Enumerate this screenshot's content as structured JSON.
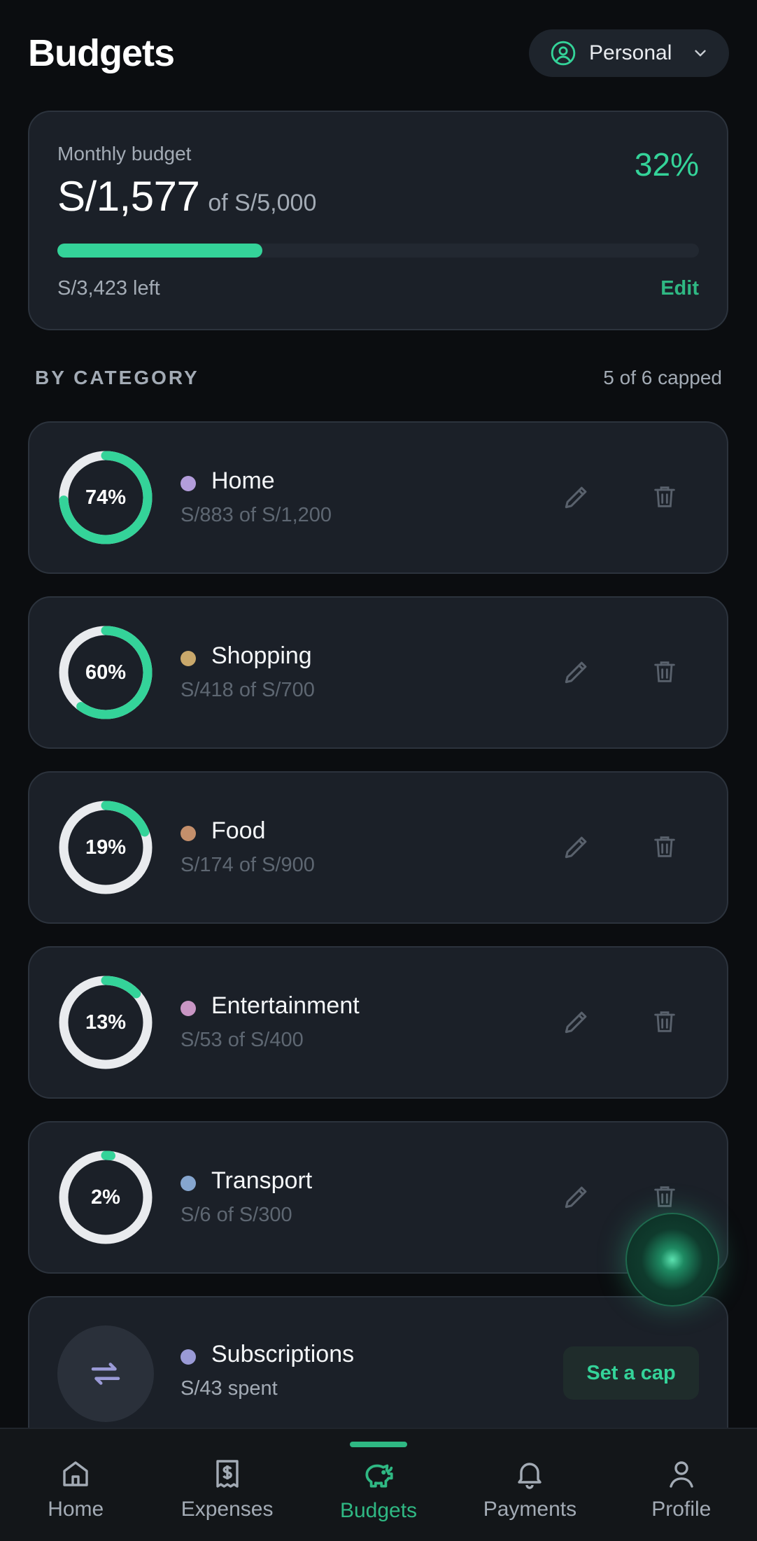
{
  "header": {
    "title": "Budgets",
    "profile_label": "Personal"
  },
  "monthly": {
    "label": "Monthly budget",
    "amount": "S/1,577",
    "of_total": "of S/5,000",
    "percent": "32%",
    "progress_fraction": 0.32,
    "left_text": "S/3,423 left",
    "edit_label": "Edit"
  },
  "section": {
    "title": "BY CATEGORY",
    "count": "5 of 6 capped"
  },
  "categories": [
    {
      "name": "Home",
      "sub": "S/883 of S/1,200",
      "percent_label": "74%",
      "fraction": 0.74,
      "dot_color": "#b39ddb"
    },
    {
      "name": "Shopping",
      "sub": "S/418 of S/700",
      "percent_label": "60%",
      "fraction": 0.6,
      "dot_color": "#c9a86b"
    },
    {
      "name": "Food",
      "sub": "S/174 of S/900",
      "percent_label": "19%",
      "fraction": 0.19,
      "dot_color": "#c48f6b"
    },
    {
      "name": "Entertainment",
      "sub": "S/53 of S/400",
      "percent_label": "13%",
      "fraction": 0.13,
      "dot_color": "#c996c4"
    },
    {
      "name": "Transport",
      "sub": "S/6 of S/300",
      "percent_label": "2%",
      "fraction": 0.02,
      "dot_color": "#86a6cf"
    }
  ],
  "subscriptions": {
    "name": "Subscriptions",
    "sub": "S/43 spent",
    "dot_color": "#9a9ad6",
    "cap_label": "Set a cap"
  },
  "nav": {
    "home": "Home",
    "expenses": "Expenses",
    "budgets": "Budgets",
    "payments": "Payments",
    "profile": "Profile"
  },
  "colors": {
    "accent": "#34d399",
    "ring_track": "#e9ebee"
  }
}
